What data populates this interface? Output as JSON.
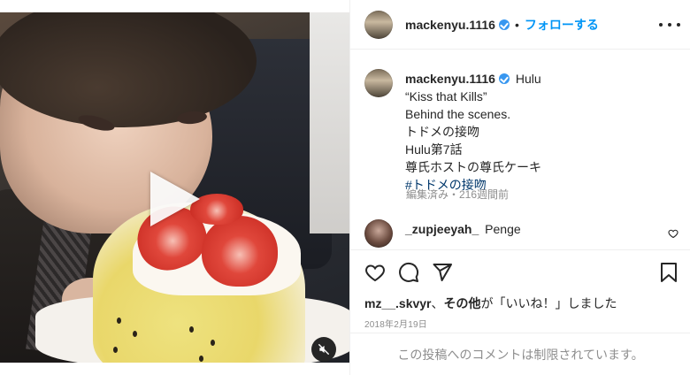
{
  "post": {
    "username": "mackenyu.1116",
    "follow_label": "フォローする",
    "separator": "•",
    "caption_prefix": "Hulu",
    "caption_lines": "“Kiss that Kills”\nBehind the scenes.\nトドメの接吻\nHulu第7話\n尊氏ホストの尊氏ケーキ",
    "hashtag": "#トドメの接吻",
    "meta": "編集済み・216週間前",
    "likes_user": "mz__.skvyr",
    "likes_and": "、",
    "likes_others": "その他",
    "likes_suffix": "が「いいね！」しました",
    "date": "2018年2月19日",
    "comments_disabled": "この投稿へのコメントは制限されています。"
  },
  "comment": {
    "username": "_zupjeeyah_",
    "text": "Penge"
  },
  "icons": {
    "verified": "verified-badge-icon",
    "more": "more-options-icon",
    "like": "heart-icon",
    "comment": "comment-icon",
    "share": "share-paper-plane-icon",
    "save": "bookmark-icon",
    "mute": "muted-speaker-icon",
    "play": "play-icon"
  },
  "colors": {
    "accent": "#0095f6",
    "verified": "#3897f0",
    "hashtag": "#00376b",
    "muted_text": "#8e8e8e",
    "text": "#262626"
  }
}
